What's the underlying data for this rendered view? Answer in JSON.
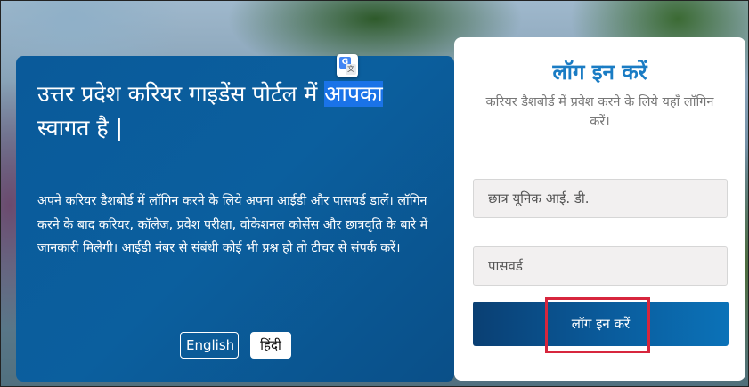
{
  "welcome": {
    "text_main": "उत्तर प्रदेश करियर गाइडेंस पोर्टल में ",
    "text_highlight": "आपका",
    "text_end": " स्वागत है |"
  },
  "translate_badge": {
    "g": "G",
    "a": "文"
  },
  "description": "अपने करियर डैशबोर्ड में लॉगिन करने के लिये अपना आईडी और पासवर्ड डालें। लॉगिन करने के बाद करियर, कॉलेज, प्रवेश परीक्षा, वोकेशनल कोर्सेस और छात्रवृति के बारे में जानकारी मिलेगी। आईडी नंबर से संबंधी कोई भी प्रश्न हो तो टीचर से संपर्क करें।",
  "language": {
    "english": "English",
    "hindi": "हिंदी"
  },
  "login": {
    "title": "लॉग इन करें",
    "subtitle": "करियर डैशबोर्ड में प्रवेश करने के लिये यहाँ लॉगिन करें।",
    "student_id_placeholder": "छात्र यूनिक आई. डी.",
    "password_placeholder": "पासवर्ड",
    "button_label": "लॉग इन करें"
  },
  "colors": {
    "panel_blue": "#0b5f9e",
    "title_blue": "#1a7cc4",
    "highlight_red": "#d7263d"
  }
}
